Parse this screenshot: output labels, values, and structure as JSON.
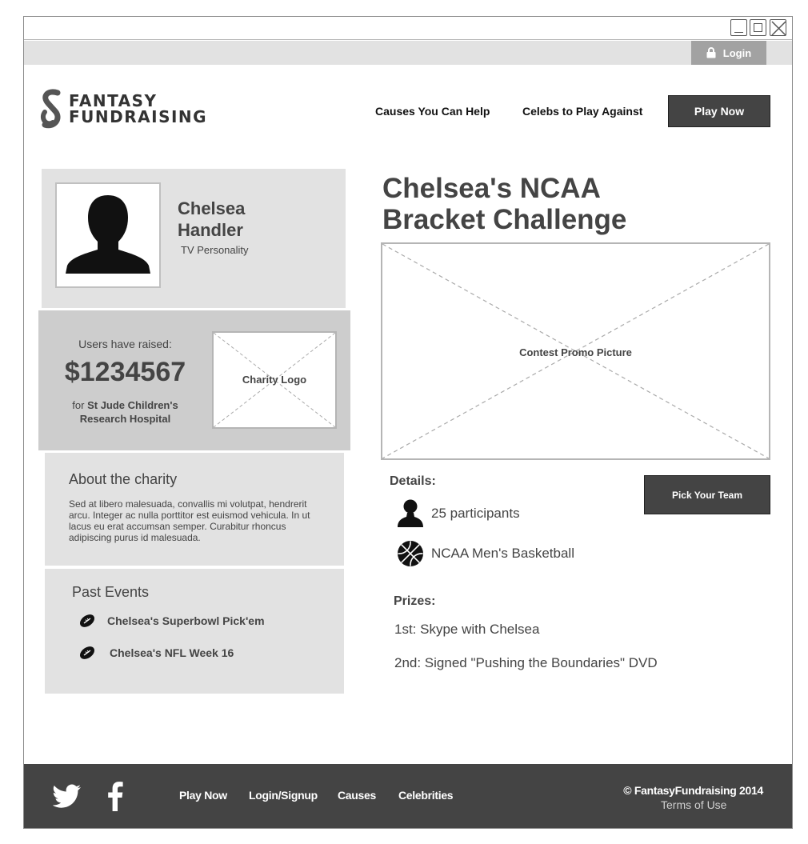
{
  "window": {
    "controls": [
      "minimize-icon",
      "maximize-icon",
      "close-icon"
    ]
  },
  "topbar": {
    "login_label": "Login",
    "login_icon": "lock-icon"
  },
  "header": {
    "logo_line1": "FANTASY",
    "logo_line2": "FUNDRAISING",
    "nav": {
      "causes": "Causes You Can Help",
      "celebs": "Celebs to Play Against"
    },
    "play_now": "Play Now"
  },
  "profile": {
    "name_line1": "Chelsea",
    "name_line2": "Handler",
    "role": "TV Personality"
  },
  "raised": {
    "label": "Users have raised:",
    "amount": "$1234567",
    "for_prefix": "for",
    "charity_name": "St Jude Children's Research Hospital",
    "charity_logo_label": "Charity Logo"
  },
  "about": {
    "title": "About the charity",
    "text": "Sed at libero malesuada, convallis mi volutpat, hendrerit arcu. Integer ac nulla porttitor est euismod vehicula. In ut lacus eu erat accumsan semper. Curabitur rhoncus adipiscing purus id malesuada."
  },
  "past_events": {
    "title": "Past Events",
    "items": [
      {
        "label": "Chelsea's Superbowl Pick'em",
        "icon": "football-icon"
      },
      {
        "label": "Chelsea's NFL Week 16",
        "icon": "football-icon"
      }
    ]
  },
  "contest": {
    "title_line1": "Chelsea's NCAA",
    "title_line2": "Bracket Challenge",
    "promo_label": "Contest Promo Picture",
    "details_title": "Details:",
    "pick_team": "Pick Your Team",
    "participants": "25 participants",
    "sport": "NCAA Men's Basketball",
    "prizes_title": "Prizes:",
    "prizes": [
      "1st: Skype with Chelsea",
      "2nd: Signed \"Pushing the Boundaries\" DVD"
    ]
  },
  "footer": {
    "links": [
      "Play Now",
      "Login/Signup",
      "Causes",
      "Celebrities"
    ],
    "copyright": "© FantasyFundraising 2014",
    "terms": "Terms of Use"
  }
}
